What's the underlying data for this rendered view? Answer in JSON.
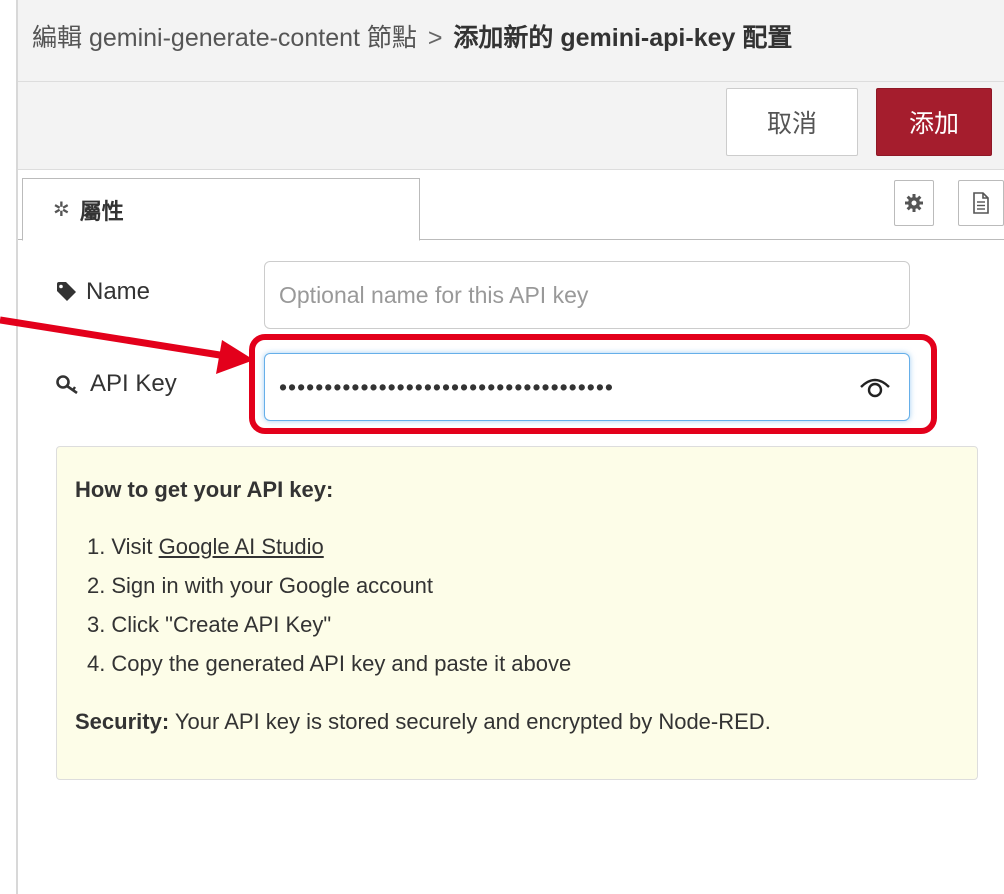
{
  "header": {
    "breadcrumb_parent": "編輯 gemini-generate-content 節點",
    "breadcrumb_separator": ">",
    "breadcrumb_current": "添加新的 gemini-api-key 配置"
  },
  "toolbar": {
    "cancel_label": "取消",
    "add_label": "添加"
  },
  "tabs": {
    "properties_label": "屬性"
  },
  "form": {
    "name_label": "Name",
    "name_placeholder": "Optional name for this API key",
    "api_key_label": "API Key",
    "api_key_value": "•••••••••••••••••••••••••••••••••••••"
  },
  "help": {
    "title": "How to get your API key:",
    "steps": [
      {
        "num": "1.",
        "prefix": "Visit ",
        "link": "Google AI Studio",
        "text": ""
      },
      {
        "num": "2.",
        "text": "Sign in with your Google account"
      },
      {
        "num": "3.",
        "text": "Click \"Create API Key\""
      },
      {
        "num": "4.",
        "text": "Copy the generated API key and paste it above"
      }
    ],
    "security_label": "Security:",
    "security_text": " Your API key is stored securely and encrypted by Node-RED."
  },
  "colors": {
    "accent_red": "#a51d2d",
    "annotation_red": "#e3001b",
    "help_background": "#fdfde8",
    "focus_blue": "#66afe9"
  },
  "icons": {
    "tag": "tag-icon",
    "key": "key-icon",
    "eye": "eye-icon",
    "gear": "gear-icon",
    "document": "document-icon"
  }
}
